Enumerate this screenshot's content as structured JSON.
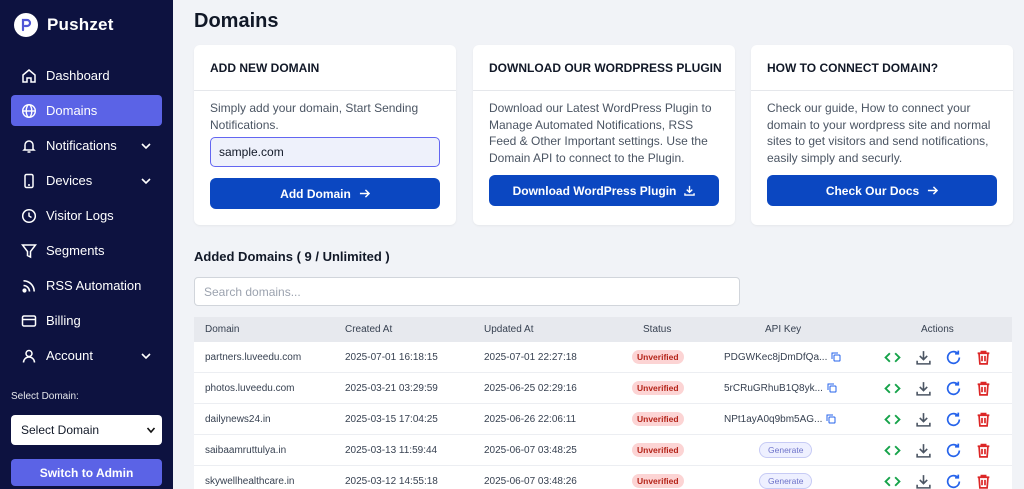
{
  "brand": {
    "name": "Pushzet"
  },
  "sidebar": {
    "items": [
      {
        "label": "Dashboard",
        "icon": "home-icon",
        "active": false,
        "has_chevron": false
      },
      {
        "label": "Domains",
        "icon": "globe-icon",
        "active": true,
        "has_chevron": false
      },
      {
        "label": "Notifications",
        "icon": "bell-icon",
        "active": false,
        "has_chevron": true
      },
      {
        "label": "Devices",
        "icon": "device-icon",
        "active": false,
        "has_chevron": true
      },
      {
        "label": "Visitor Logs",
        "icon": "clock-icon",
        "active": false,
        "has_chevron": false
      },
      {
        "label": "Segments",
        "icon": "filter-icon",
        "active": false,
        "has_chevron": false
      },
      {
        "label": "RSS Automation",
        "icon": "rss-icon",
        "active": false,
        "has_chevron": false
      },
      {
        "label": "Billing",
        "icon": "card-icon",
        "active": false,
        "has_chevron": false
      },
      {
        "label": "Account",
        "icon": "user-icon",
        "active": false,
        "has_chevron": true
      }
    ],
    "select_label": "Select Domain:",
    "select_value": "Select Domain",
    "switch_label": "Switch to Admin"
  },
  "page": {
    "title": "Domains"
  },
  "cards": {
    "add": {
      "title": "ADD NEW DOMAIN",
      "text": "Simply add your domain, Start Sending Notifications.",
      "input_value": "sample.com",
      "button": "Add Domain"
    },
    "plugin": {
      "title": "DOWNLOAD OUR WORDPRESS PLUGIN",
      "text": "Download our Latest WordPress Plugin to Manage Automated Notifications, RSS Feed & Other Important settings. Use the Domain API to connect to the Plugin.",
      "button": "Download WordPress Plugin"
    },
    "connect": {
      "title": "HOW TO CONNECT DOMAIN?",
      "text": "Check our guide, How to connect your domain to your wordpress site and normal sites to get visitors and send notifications, easily simply and securly.",
      "button": "Check Our Docs"
    }
  },
  "domains": {
    "heading": "Added Domains ( 9 / Unlimited )",
    "search_placeholder": "Search domains...",
    "columns": {
      "domain": "Domain",
      "created": "Created At",
      "updated": "Updated At",
      "status": "Status",
      "api": "API Key",
      "actions": "Actions"
    },
    "rows": [
      {
        "domain": "partners.luveedu.com",
        "created": "2025-07-01 16:18:15",
        "updated": "2025-07-01 22:27:18",
        "status": "Unverified",
        "api_key": "PDGWKec8jDmDfQa...",
        "generate": ""
      },
      {
        "domain": "photos.luveedu.com",
        "created": "2025-03-21 03:29:59",
        "updated": "2025-06-25 02:29:16",
        "status": "Unverified",
        "api_key": "5rCRuGRhuB1Q8yk...",
        "generate": ""
      },
      {
        "domain": "dailynews24.in",
        "created": "2025-03-15 17:04:25",
        "updated": "2025-06-26 22:06:11",
        "status": "Unverified",
        "api_key": "NPt1ayA0q9bm5AG...",
        "generate": ""
      },
      {
        "domain": "saibaamruttulya.in",
        "created": "2025-03-13 11:59:44",
        "updated": "2025-06-07 03:48:25",
        "status": "Unverified",
        "api_key": "",
        "generate": "Generate"
      },
      {
        "domain": "skywellhealthcare.in",
        "created": "2025-03-12 14:55:18",
        "updated": "2025-06-07 03:48:26",
        "status": "Unverified",
        "api_key": "",
        "generate": "Generate"
      }
    ]
  },
  "colors": {
    "sidebar_bg": "#0d1240",
    "active_nav": "#5b63e6",
    "primary_button": "#0b47c1",
    "badge_bg": "#fcd4d4",
    "badge_text": "#b42318",
    "code_icon": "#16a34a",
    "refresh_icon": "#2563eb",
    "delete_icon": "#dc2626"
  }
}
